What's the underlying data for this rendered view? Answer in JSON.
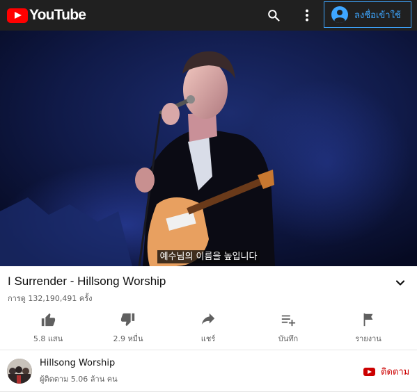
{
  "header": {
    "logo_text": "YouTube",
    "signin_label": "ลงชื่อเข้าใช้",
    "icons": [
      "youtube-logo-icon",
      "search-icon",
      "more-vert-icon",
      "account-circle-icon"
    ],
    "accent_color": "#3ea6ff",
    "brand_color": "#ff0000"
  },
  "video": {
    "caption": "예수님의 이름을 높입니다"
  },
  "info": {
    "title": "I Surrender - Hillsong Worship",
    "views": "การดู 132,190,491 ครั้ง"
  },
  "actions": [
    {
      "icon": "thumb-up-icon",
      "label": "5.8 แสน"
    },
    {
      "icon": "thumb-down-icon",
      "label": "2.9 หมื่น"
    },
    {
      "icon": "share-icon",
      "label": "แชร์"
    },
    {
      "icon": "playlist-add-icon",
      "label": "บันทึก"
    },
    {
      "icon": "flag-icon",
      "label": "รายงาน"
    }
  ],
  "channel": {
    "name": "Hillsong Worship",
    "subscribers": "ผู้ติดตาม 5.06 ล้าน คน",
    "subscribe_label": "ติดตาม",
    "subscribe_color": "#cc0000"
  }
}
